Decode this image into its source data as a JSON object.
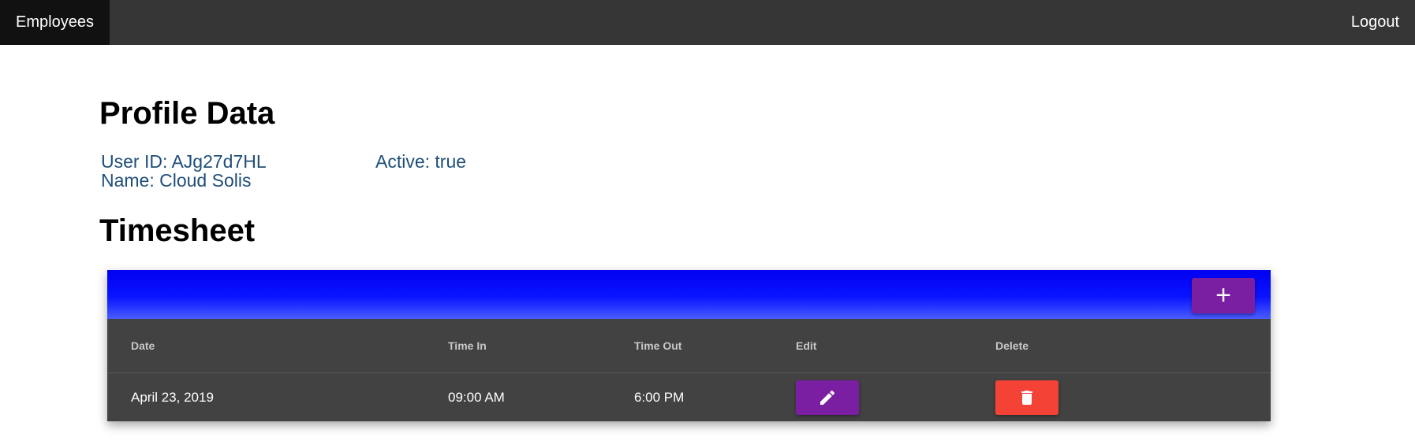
{
  "nav": {
    "active_item": "Employees",
    "logout_label": "Logout",
    "background_color": "#363636"
  },
  "profile": {
    "title": "Profile Data",
    "user_id_label": "User ID: AJg27d7HL",
    "name_label": "Name: Cloud Solis",
    "active_label": "Active: true"
  },
  "timesheet": {
    "title": "Timesheet",
    "add_button_label": "+",
    "columns": [
      "Date",
      "Time In",
      "Time Out",
      "Edit",
      "Delete"
    ],
    "rows": [
      {
        "date": "April 23, 2019",
        "time_in": "09:00 AM",
        "time_out": "6:00 PM"
      }
    ]
  },
  "icons": {
    "edit": "pencil-icon",
    "delete": "trash-icon",
    "add": "plus-icon"
  },
  "colors": {
    "header_gradient_start": "#0000f0",
    "primary_button": "#7b1fa2",
    "danger_button": "#f44336",
    "table_background": "#424242",
    "profile_text": "#1f4e79"
  }
}
